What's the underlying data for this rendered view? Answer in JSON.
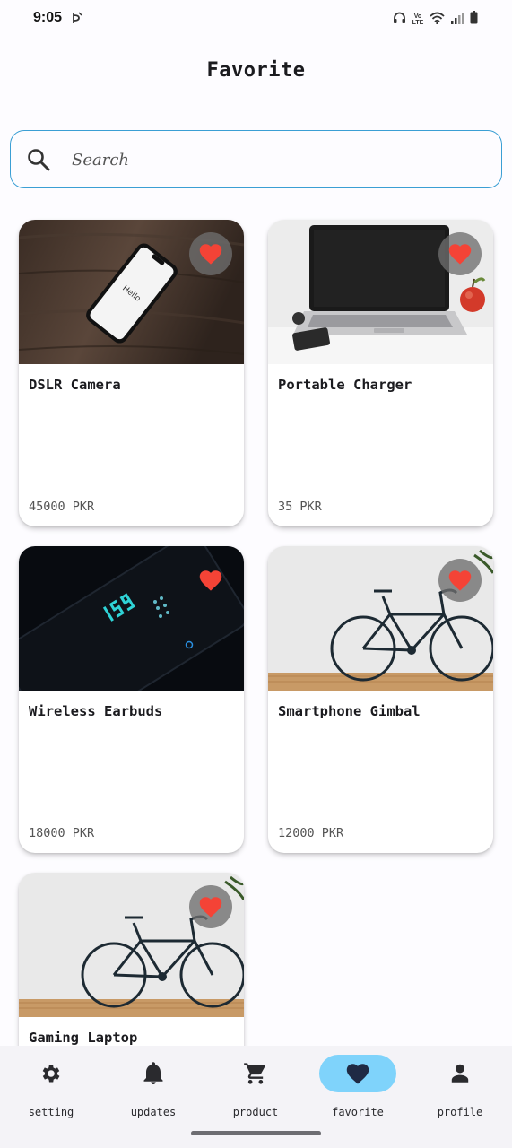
{
  "status_bar": {
    "time": "9:05",
    "network_label": "Vo LTE"
  },
  "header": {
    "title": "Favorite"
  },
  "search": {
    "placeholder": "Search",
    "value": ""
  },
  "products": [
    {
      "name": "DSLR Camera",
      "price": "45000 PKR",
      "image": "phone-on-wood",
      "favorite": true
    },
    {
      "name": "Portable Charger",
      "price": "35 PKR",
      "image": "laptop-on-desk",
      "favorite": true
    },
    {
      "name": "Wireless Earbuds",
      "price": "18000 PKR",
      "image": "dark-phone",
      "favorite": true
    },
    {
      "name": "Smartphone Gimbal",
      "price": "12000 PKR",
      "image": "bicycle",
      "favorite": true
    },
    {
      "name": "Gaming Laptop",
      "price": "",
      "image": "bicycle",
      "favorite": true
    }
  ],
  "nav": {
    "items": [
      {
        "label": "setting",
        "icon": "gear-icon"
      },
      {
        "label": "updates",
        "icon": "bell-icon"
      },
      {
        "label": "product",
        "icon": "cart-icon"
      },
      {
        "label": "favorite",
        "icon": "heart-icon"
      },
      {
        "label": "profile",
        "icon": "person-icon"
      }
    ],
    "active": "favorite"
  },
  "colors": {
    "accent": "#3b9fd4",
    "active_pill": "#7fd3fb",
    "heart": "#f44336"
  }
}
